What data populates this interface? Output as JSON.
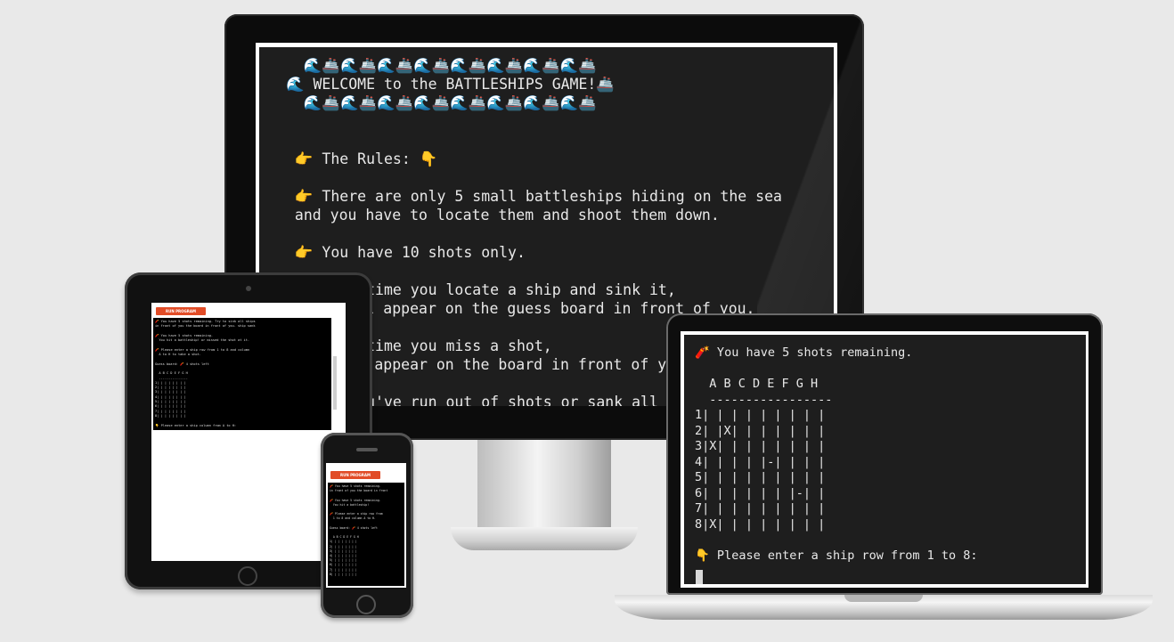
{
  "desktop": {
    "lines": [
      "  🌊🚢🌊🚢🌊🚢🌊🚢🌊🚢🌊🚢🌊🚢🌊🚢",
      "🌊 WELCOME to the BATTLESHIPS GAME!🚢",
      "  🌊🚢🌊🚢🌊🚢🌊🚢🌊🚢🌊🚢🌊🚢🌊🚢",
      "",
      "",
      " 👉 The Rules: 👇",
      "",
      " 👉 There are only 5 small battleships hiding on the sea",
      " and you have to locate them and shoot them down.",
      "",
      " 👉 You have 10 shots only.",
      "",
      " 👉 Each time you locate a ship and sink it,",
      " an X will appear on the guess board in front of you.",
      "",
      " 👉 Each time you miss a shot,",
      " a - will appear on the board in front of you.",
      "",
      " 👉 If you've run out of shots or sank all 5 ships"
    ]
  },
  "laptop": {
    "lines": [
      "🧨 You have 5 shots remaining.",
      "",
      "  A B C D E F G H",
      "  -----------------",
      "1| | | | | | | | |",
      "2| |X| | | | | | |",
      "3|X| | | | | | | |",
      "4| | | | |-| | | |",
      "5| | | | | | | | |",
      "6| | | | | | |-| |",
      "7| | | | | | | | |",
      "8|X| | | | | | | |",
      "",
      "👇 Please enter a ship row from 1 to 8:"
    ]
  },
  "tablet": {
    "button_label": "RUN PROGRAM",
    "lines": [
      "🧨 You have 5 shots remaining. Try to sink all ships",
      "in front of you the board in front of you. ship sank",
      "",
      "🧨 You have 5 shots remaining.",
      "  You hit a battleship! or missed the shot at it.",
      "",
      "🧨 Please enter a ship row from 1 to 8 and column",
      "  A to H to take a shot.",
      "",
      "Guess board: 🧨 4 shots left",
      "",
      "  A B C D E F G H",
      "  ---------------",
      "1| | | | | | | |",
      "2| | | | | | | |",
      "3| | | | | | | |",
      "4| | | | | | | |",
      "5| | | | | | | |",
      "6| | | | | | | |",
      "7| | | | | | | |",
      "8| | | | | | | |",
      "",
      "👇 Please enter a ship column from A to H:"
    ]
  },
  "phone": {
    "button_label": "RUN PROGRAM",
    "lines": [
      "🧨 You have 5 shots remaining.",
      "in front of you the board in front",
      "",
      "🧨 You have 5 shots remaining.",
      "  You hit a battleship!",
      "",
      "🧨 Please enter a ship row from",
      "  1 to 8 and column A to H.",
      "",
      "Guess board: 🧨 4 shots left",
      "",
      "  A B C D E F G H",
      "1| | | | | | | |",
      "2| | | | | | | |",
      "3| | | | | | | |",
      "4| | | | | | | |",
      "5| | | | | | | |",
      "6| | | | | | | |",
      "7| | | | | | | |",
      "8| | | | | | | |"
    ]
  }
}
